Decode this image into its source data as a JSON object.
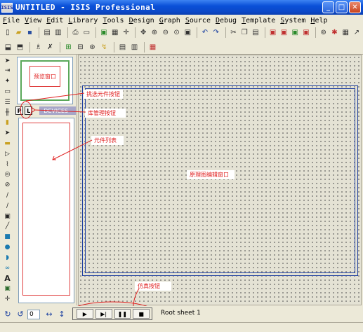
{
  "window": {
    "icon_text": "ISIS",
    "title": "UNTITLED - ISIS Professional",
    "minimize": "_",
    "maximize": "□",
    "close": "✕"
  },
  "menu": [
    "File",
    "View",
    "Edit",
    "Library",
    "Tools",
    "Design",
    "Graph",
    "Source",
    "Debug",
    "Template",
    "System",
    "Help"
  ],
  "toolbar1_icons": [
    "new-icon",
    "open-icon",
    "save-icon",
    "import-icon",
    "export-icon",
    "print-icon",
    "print-area-icon",
    "refresh-icon",
    "grid-icon",
    "origin-icon",
    "pan-icon",
    "zoom-in-icon",
    "zoom-out-icon",
    "zoom-all-icon",
    "zoom-area-icon",
    "undo-icon",
    "redo-icon",
    "cut-icon",
    "copy-icon",
    "paste-icon",
    "block-copy-icon",
    "block-move-icon",
    "block-rotate-icon",
    "block-delete-icon",
    "pick-device-icon",
    "make-device-icon",
    "decompose-icon",
    "wire-autorouter-icon"
  ],
  "toolbar2_icons": [
    "search-icon",
    "property-tool-icon",
    "new-sheet-icon",
    "remove-sheet-icon",
    "goto-sheet-icon",
    "zoom-child-icon",
    "zoom-parent-icon",
    "bom-icon",
    "erc-icon",
    "netlist-icon",
    "ares-icon"
  ],
  "vtoolbar_icons": [
    "selection-icon",
    "component-icon",
    "junction-icon",
    "wire-label-icon",
    "text-script-icon",
    "bus-icon",
    "subcircuit-icon",
    "terminal-icon",
    "pin-icon",
    "graph-icon",
    "tape-icon",
    "generator-icon",
    "probe-voltage-icon",
    "probe-current-icon",
    "virtual-instrument-icon",
    "line-icon",
    "box-icon",
    "circle-icon",
    "arc-icon",
    "path-icon",
    "text-icon",
    "symbol-icon",
    "marker-icon"
  ],
  "leftpanel": {
    "preview_label": "预览窗口",
    "p_button": "P",
    "l_button": "L",
    "devices_tab": "DEVICES"
  },
  "annotations": {
    "pick_device": "挑选元件按钮",
    "library_manager": "库管理按钮",
    "device_list": "元件列表",
    "schematic_window": "原理图编辑窗口",
    "sim_buttons": "仿真按钮"
  },
  "bottombar": {
    "rotation_value": "0",
    "play": "▶",
    "step": "▶|",
    "pause": "❚❚",
    "stop": "■",
    "root_sheet": "Root sheet 1"
  }
}
